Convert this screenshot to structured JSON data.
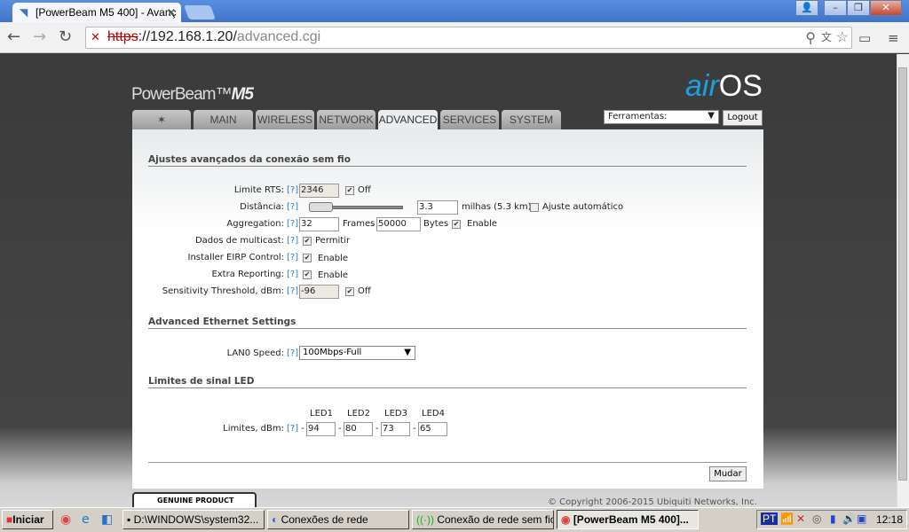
{
  "browser": {
    "tab_title": "[PowerBeam M5 400] - Avanç",
    "url_scheme": "https",
    "url_host": "://192.168.1.20/",
    "url_path": "advanced.cgi"
  },
  "header": {
    "brand": "PowerBeam",
    "brand_model": "M5",
    "logo_air": "air",
    "logo_os": "OS",
    "tabs": [
      "MAIN",
      "WIRELESS",
      "NETWORK",
      "ADVANCED",
      "SERVICES",
      "SYSTEM"
    ],
    "active_tab": "ADVANCED",
    "tools_select": "Ferramentas:",
    "logout": "Logout"
  },
  "wireless": {
    "title": "Ajustes avançados da conexão sem fio",
    "help": "[?]",
    "rts": {
      "label": "Limite RTS:",
      "value": "2346",
      "off_label": "Off",
      "off_checked": true
    },
    "distance": {
      "label": "Distância:",
      "value": "3.3",
      "unit": "milhas (5.3 km)",
      "auto_label": "Ajuste automático",
      "auto_checked": false,
      "slider_fraction": 0.05
    },
    "aggregation": {
      "label": "Aggregation:",
      "frames": "32",
      "frames_label": "Frames",
      "bytes": "50000",
      "bytes_label": "Bytes",
      "enable_label": "Enable",
      "enabled": true
    },
    "multicast": {
      "label": "Dados de multicast:",
      "option": "Permitir",
      "checked": true
    },
    "eirp": {
      "label": "Installer EIRP Control:",
      "option": "Enable",
      "checked": true
    },
    "extra": {
      "label": "Extra Reporting:",
      "option": "Enable",
      "checked": true
    },
    "sensitivity": {
      "label": "Sensitivity Threshold, dBm:",
      "value": "-96",
      "off_label": "Off",
      "off_checked": true
    }
  },
  "ethernet": {
    "title": "Advanced Ethernet Settings",
    "lan0_label": "LAN0 Speed:",
    "lan0_value": "100Mbps-Full"
  },
  "led": {
    "title": "Limites de sinal LED",
    "row_label": "Limites, dBm:",
    "headers": [
      "LED1",
      "LED2",
      "LED3",
      "LED4"
    ],
    "values": [
      "94",
      "80",
      "73",
      "65"
    ],
    "sep": "-"
  },
  "footer": {
    "save": "Mudar",
    "genuine": "GENUINE  PRODUCT",
    "copyright": "© Copyright 2006-2015 Ubiquiti Networks, Inc."
  },
  "taskbar": {
    "start": "Iniciar",
    "items": [
      "D:\\WINDOWS\\system32...",
      "Conexões de rede",
      "Conexão de rede sem fio",
      "[PowerBeam M5 400]..."
    ],
    "clock": "12:18"
  }
}
